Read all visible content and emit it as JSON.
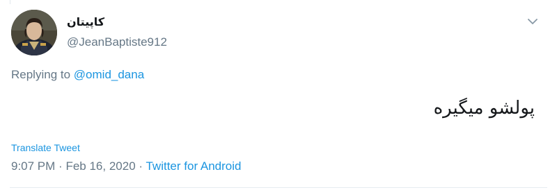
{
  "tweet": {
    "display_name": "کاپیتان",
    "handle": "@JeanBaptiste912",
    "replying_prefix": "Replying to",
    "replying_to": "@omid_dana",
    "text": "پولشو میگیره",
    "translate_label": "Translate Tweet",
    "time": "9:07 PM",
    "separator": "·",
    "date": "Feb 16, 2020",
    "source": "Twitter for Android"
  },
  "icons": {
    "menu": "chevron-down-icon",
    "avatar": "avatar"
  },
  "colors": {
    "link": "#1b95e0",
    "secondary_text": "#657786",
    "primary_text": "#14171a",
    "divider": "#e6ecf0"
  }
}
